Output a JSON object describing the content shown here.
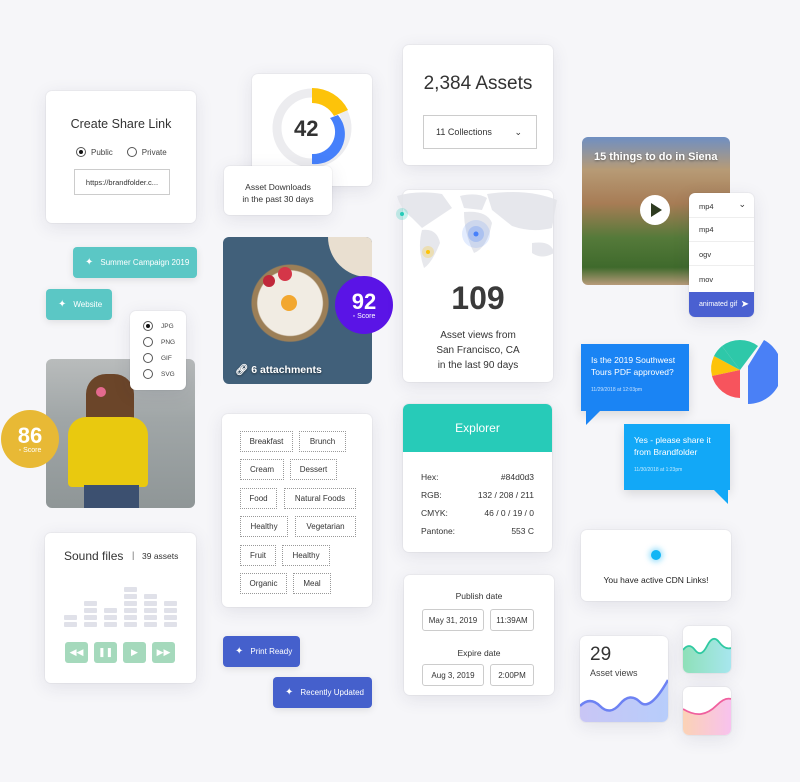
{
  "share_link": {
    "title": "Create Share Link",
    "options": [
      {
        "label": "Public",
        "selected": true
      },
      {
        "label": "Private",
        "selected": false
      }
    ],
    "url_value": "https://brandfolder.c..."
  },
  "downloads": {
    "value": "42",
    "label_line1": "Asset Downloads",
    "label_line2": "in the past 30 days"
  },
  "assets": {
    "title": "2,384 Assets",
    "collections_select": "11 Collections"
  },
  "video": {
    "title": "15 things to do in Siena",
    "format_select": "mp4",
    "format_options": [
      "mp4",
      "ogv",
      "mov",
      "animated gif"
    ],
    "highlighted_option": "animated gif"
  },
  "pills": {
    "summer": "Summer Campaign 2019",
    "website": "Website",
    "print_ready": "Print Ready",
    "recently_updated": "Recently Updated"
  },
  "file_format": {
    "options": [
      {
        "label": "JPG",
        "selected": true
      },
      {
        "label": "PNG",
        "selected": false
      },
      {
        "label": "GIF",
        "selected": false
      },
      {
        "label": "SVG",
        "selected": false
      }
    ]
  },
  "food_photo": {
    "attachments": "6 attachments"
  },
  "score_92": {
    "value": "92",
    "label": "Score",
    "color": "#5a14e6"
  },
  "score_86": {
    "value": "86",
    "label": "Score",
    "color": "#e8b935"
  },
  "map": {
    "value": "109",
    "line1": "Asset views from",
    "line2": "San Francisco, CA",
    "line3": "in the last 90 days"
  },
  "tags": [
    "Breakfast",
    "Brunch",
    "Cream",
    "Dessert",
    "Food",
    "Natural Foods",
    "Healthy",
    "Vegetarian",
    "Fruit",
    "Healthy",
    "Organic",
    "Meal"
  ],
  "explorer": {
    "title": "Explorer",
    "rows": [
      {
        "label": "Hex:",
        "value": "#84d0d3"
      },
      {
        "label": "RGB:",
        "value": "132 / 208 / 211"
      },
      {
        "label": "CMYK:",
        "value": "46 / 0 / 19 / 0"
      },
      {
        "label": "Pantone:",
        "value": "553 C"
      }
    ],
    "header_color": "#27cbb8"
  },
  "dates": {
    "publish_label": "Publish date",
    "publish_date": "May 31, 2019",
    "publish_time": "11:39AM",
    "expire_label": "Expire date",
    "expire_date": "Aug 3, 2019",
    "expire_time": "2:00PM"
  },
  "sound": {
    "title": "Sound files",
    "separator": "|",
    "count": "39 assets",
    "bar_levels": [
      2,
      4,
      3,
      6,
      5,
      4
    ]
  },
  "chat": {
    "q_text": "Is the 2019 Southwest Tours PDF approved?",
    "q_time": "11/29/2018 at 12:03pm",
    "a_text": "Yes - please share it from Brandfolder",
    "a_time": "11/30/2018 at 1:23pm"
  },
  "cdn": {
    "text": "You have active CDN Links!"
  },
  "views": {
    "value": "29",
    "label": "Asset views"
  }
}
